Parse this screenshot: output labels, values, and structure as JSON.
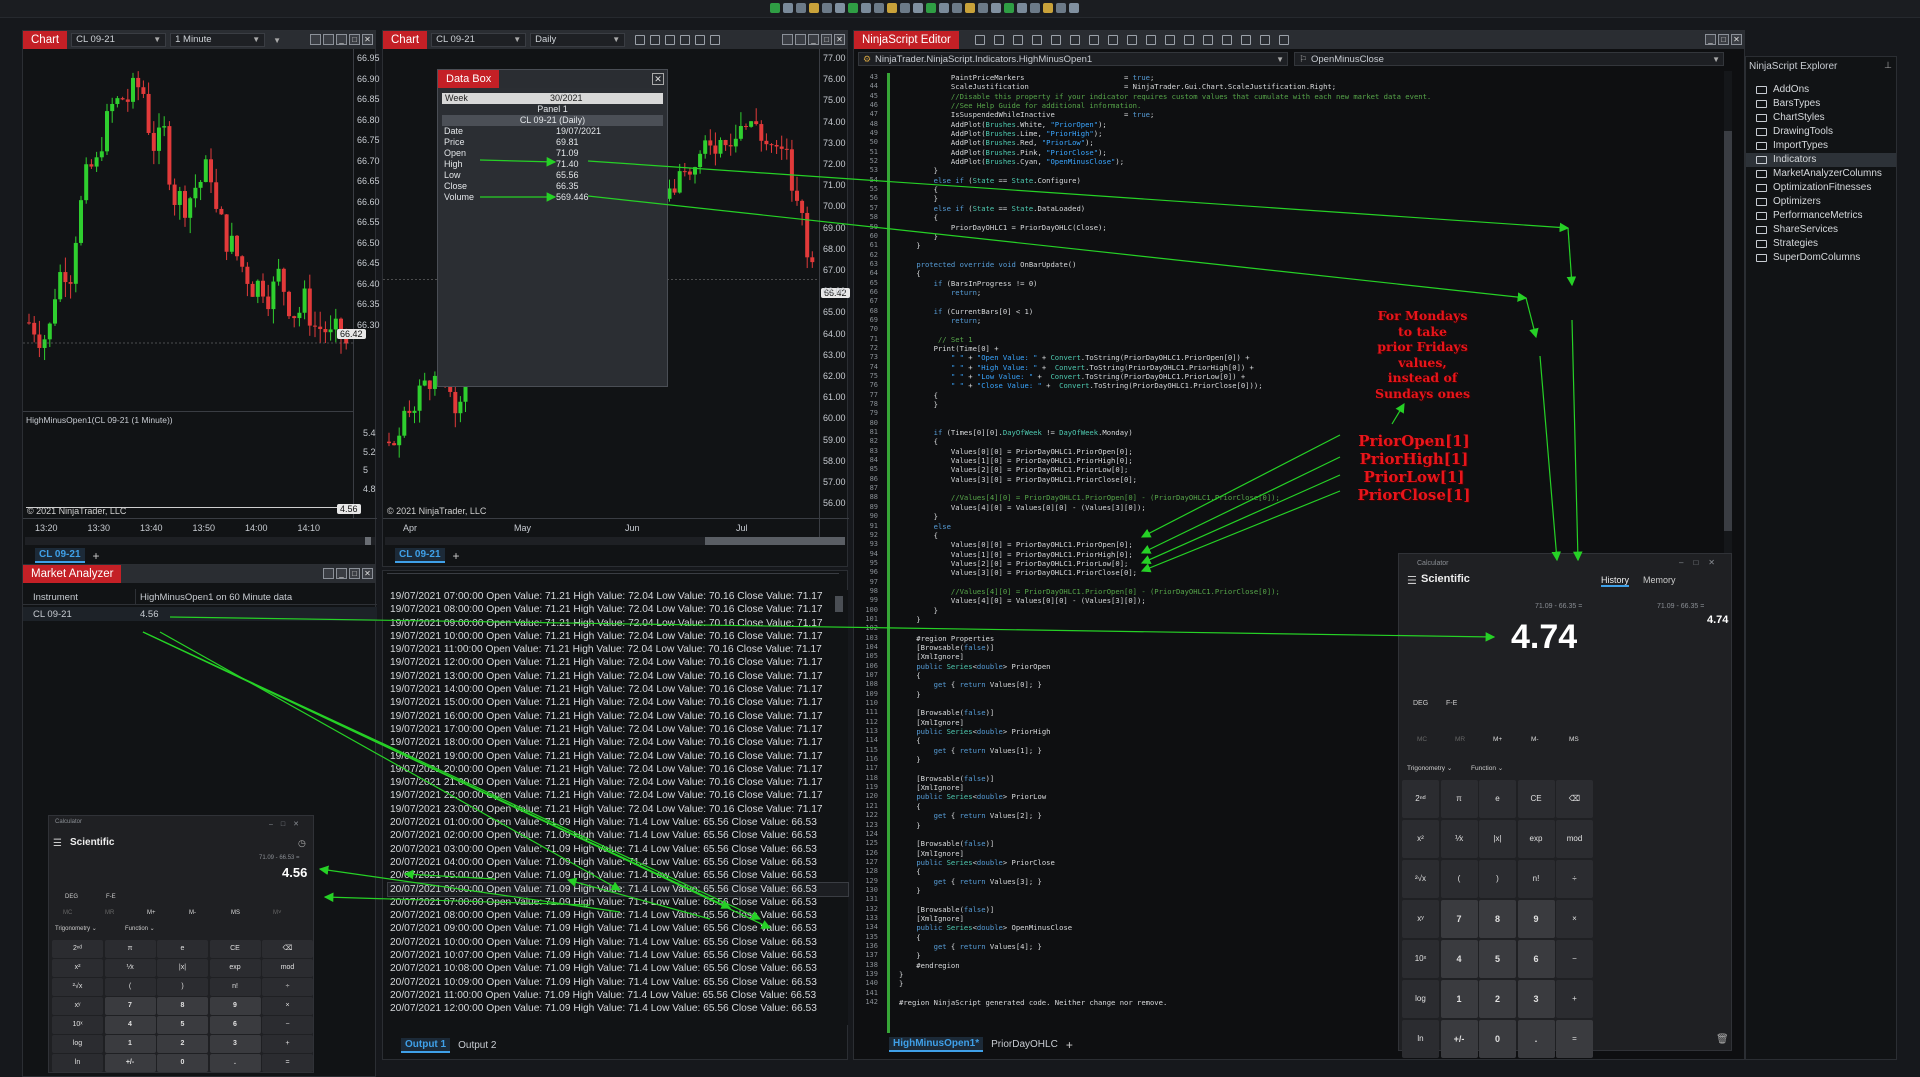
{
  "top": {
    "icons": 24
  },
  "chart1": {
    "tab": "Chart",
    "instrument": "CL 09-21",
    "interval": "1 Minute",
    "prices": [
      "66.95",
      "66.90",
      "66.85",
      "66.80",
      "66.75",
      "66.70",
      "66.65",
      "66.60",
      "66.55",
      "66.50",
      "66.45",
      "66.40",
      "66.35",
      "66.30"
    ],
    "last_price": "66.42",
    "indicator_label": "HighMinusOpen1(CL 09-21 (1 Minute))",
    "indicator_ticks": [
      "5.4",
      "5.2",
      "5",
      "4.8"
    ],
    "indicator_value": "4.56",
    "times": [
      "13:20",
      "13:30",
      "13:40",
      "13:50",
      "14:00",
      "14:10"
    ],
    "copyright": "© 2021 NinjaTrader, LLC",
    "bottom_tab": "CL 09-21",
    "plus": "+"
  },
  "chart2": {
    "tab": "Chart",
    "instrument": "CL 09-21",
    "interval": "Daily",
    "prices": [
      "77.00",
      "76.00",
      "75.00",
      "74.00",
      "73.00",
      "72.00",
      "71.00",
      "70.00",
      "69.00",
      "68.00",
      "67.00",
      "66.00",
      "65.00",
      "64.00",
      "63.00",
      "62.00",
      "61.00",
      "60.00",
      "59.00",
      "58.00",
      "57.00",
      "56.00"
    ],
    "last_price": "66.42",
    "months": [
      "Apr",
      "May",
      "Jun",
      "Jul"
    ],
    "copyright": "© 2021 NinjaTrader, LLC",
    "bottom_tab": "CL 09-21",
    "plus": "+"
  },
  "databox": {
    "title": "Data Box",
    "close": "✕",
    "week_label": "Week",
    "week_value": "30/2021",
    "panel": "Panel 1",
    "series": "CL 09-21 (Daily)",
    "rows": [
      {
        "k": "Date",
        "v": "19/07/2021"
      },
      {
        "k": "Price",
        "v": "69.81"
      },
      {
        "k": "Open",
        "v": "71.09"
      },
      {
        "k": "High",
        "v": "71.40"
      },
      {
        "k": "Low",
        "v": "65.56"
      },
      {
        "k": "Close",
        "v": "66.35"
      },
      {
        "k": "Volume",
        "v": "569.446"
      }
    ]
  },
  "market_analyzer": {
    "tab": "Market Analyzer",
    "col1": "Instrument",
    "col2": "HighMinusOpen1 on 60 Minute data",
    "row_instrument": "CL 09-21",
    "row_value": "4.56"
  },
  "output": {
    "lines": [
      "19/07/2021 07:00:00 Open Value: 71.21 High Value: 72.04 Low Value: 70.16 Close Value: 71.17",
      "19/07/2021 08:00:00 Open Value: 71.21 High Value: 72.04 Low Value: 70.16 Close Value: 71.17",
      "19/07/2021 09:00:00 Open Value: 71.21 High Value: 72.04 Low Value: 70.16 Close Value: 71.17",
      "19/07/2021 10:00:00 Open Value: 71.21 High Value: 72.04 Low Value: 70.16 Close Value: 71.17",
      "19/07/2021 11:00:00 Open Value: 71.21 High Value: 72.04 Low Value: 70.16 Close Value: 71.17",
      "19/07/2021 12:00:00 Open Value: 71.21 High Value: 72.04 Low Value: 70.16 Close Value: 71.17",
      "19/07/2021 13:00:00 Open Value: 71.21 High Value: 72.04 Low Value: 70.16 Close Value: 71.17",
      "19/07/2021 14:00:00 Open Value: 71.21 High Value: 72.04 Low Value: 70.16 Close Value: 71.17",
      "19/07/2021 15:00:00 Open Value: 71.21 High Value: 72.04 Low Value: 70.16 Close Value: 71.17",
      "19/07/2021 16:00:00 Open Value: 71.21 High Value: 72.04 Low Value: 70.16 Close Value: 71.17",
      "19/07/2021 17:00:00 Open Value: 71.21 High Value: 72.04 Low Value: 70.16 Close Value: 71.17",
      "19/07/2021 18:00:00 Open Value: 71.21 High Value: 72.04 Low Value: 70.16 Close Value: 71.17",
      "19/07/2021 19:00:00 Open Value: 71.21 High Value: 72.04 Low Value: 70.16 Close Value: 71.17",
      "19/07/2021 20:00:00 Open Value: 71.21 High Value: 72.04 Low Value: 70.16 Close Value: 71.17",
      "19/07/2021 21:00:00 Open Value: 71.21 High Value: 72.04 Low Value: 70.16 Close Value: 71.17",
      "19/07/2021 22:00:00 Open Value: 71.21 High Value: 72.04 Low Value: 70.16 Close Value: 71.17",
      "19/07/2021 23:00:00 Open Value: 71.21 High Value: 72.04 Low Value: 70.16 Close Value: 71.17",
      "20/07/2021 01:00:00 Open Value: 71.09 High Value: 71.4 Low Value: 65.56 Close Value: 66.53",
      "20/07/2021 02:00:00 Open Value: 71.09 High Value: 71.4 Low Value: 65.56 Close Value: 66.53",
      "20/07/2021 03:00:00 Open Value: 71.09 High Value: 71.4 Low Value: 65.56 Close Value: 66.53",
      "20/07/2021 04:00:00 Open Value: 71.09 High Value: 71.4 Low Value: 65.56 Close Value: 66.53",
      "20/07/2021 05:00:00 Open Value: 71.09 High Value: 71.4 Low Value: 65.56 Close Value: 66.53",
      "20/07/2021 06:00:00 Open Value: 71.09 High Value: 71.4 Low Value: 65.56 Close Value: 66.53",
      "20/07/2021 07:00:00 Open Value: 71.09 High Value: 71.4 Low Value: 65.56 Close Value: 66.53",
      "20/07/2021 08:00:00 Open Value: 71.09 High Value: 71.4 Low Value: 65.56 Close Value: 66.53",
      "20/07/2021 09:00:00 Open Value: 71.09 High Value: 71.4 Low Value: 65.56 Close Value: 66.53",
      "20/07/2021 10:00:00 Open Value: 71.09 High Value: 71.4 Low Value: 65.56 Close Value: 66.53",
      "20/07/2021 10:07:00 Open Value: 71.09 High Value: 71.4 Low Value: 65.56 Close Value: 66.53",
      "20/07/2021 10:08:00 Open Value: 71.09 High Value: 71.4 Low Value: 65.56 Close Value: 66.53",
      "20/07/2021 10:09:00 Open Value: 71.09 High Value: 71.4 Low Value: 65.56 Close Value: 66.53",
      "20/07/2021 11:00:00 Open Value: 71.09 High Value: 71.4 Low Value: 65.56 Close Value: 66.53",
      "20/07/2021 12:00:00 Open Value: 71.09 High Value: 71.4 Low Value: 65.56 Close Value: 66.53"
    ],
    "tab1": "Output 1",
    "tab2": "Output 2"
  },
  "editor": {
    "tab": "NinjaScript Editor",
    "path": "NinjaTrader.NinjaScript.Indicators.HighMinusOpen1",
    "member": "OpenMinusClose",
    "file_tab1": "HighMinusOpen1*",
    "file_tab2": "PriorDayOHLC",
    "plus": "+",
    "first_line": 43,
    "lines": [
      "            PaintPriceMarkers                       = true;",
      "            ScaleJustification                      = NinjaTrader.Gui.Chart.ScaleJustification.Right;",
      "            //Disable this property if your indicator requires custom values that cumulate with each new market data event.",
      "            //See Help Guide for additional information.",
      "            IsSuspendedWhileInactive                = true;",
      "            AddPlot(Brushes.White, \"PriorOpen\");",
      "            AddPlot(Brushes.Lime, \"PriorHigh\");",
      "            AddPlot(Brushes.Red, \"PriorLow\");",
      "            AddPlot(Brushes.Pink, \"PriorClose\");",
      "            AddPlot(Brushes.Cyan, \"OpenMinusClose\");",
      "        }",
      "        else if (State == State.Configure)",
      "        {",
      "        }",
      "        else if (State == State.DataLoaded)",
      "        {",
      "            PriorDayOHLC1 = PriorDayOHLC(Close);",
      "        }",
      "    }",
      "",
      "    protected override void OnBarUpdate()",
      "    {",
      "        if (BarsInProgress != 0)",
      "            return;",
      "",
      "        if (CurrentBars[0] < 1)",
      "            return;",
      "",
      "         // Set 1",
      "        Print(Time[0] +",
      "            \" \" + \"Open Value: \" + Convert.ToString(PriorDayOHLC1.PriorOpen[0]) +",
      "            \" \" + \"High Value: \" +  Convert.ToString(PriorDayOHLC1.PriorHigh[0]) +",
      "            \" \" + \"Low Value: \" +  Convert.ToString(PriorDayOHLC1.PriorLow[0]) +",
      "            \" \" + \"Close Value: \" +  Convert.ToString(PriorDayOHLC1.PriorClose[0]));",
      "        {",
      "        }",
      "",
      "",
      "        if (Times[0][0].DayOfWeek != DayOfWeek.Monday)",
      "        {",
      "            Values[0][0] = PriorDayOHLC1.PriorOpen[0];",
      "            Values[1][0] = PriorDayOHLC1.PriorHigh[0];",
      "            Values[2][0] = PriorDayOHLC1.PriorLow[0];",
      "            Values[3][0] = PriorDayOHLC1.PriorClose[0];",
      "",
      "            //Values[4][0] = PriorDayOHLC1.PriorOpen[0] - (PriorDayOHLC1.PriorClose[0]);",
      "            Values[4][0] = Values[0][0] - (Values[3][0]);",
      "        }",
      "        else",
      "        {",
      "            Values[0][0] = PriorDayOHLC1.PriorOpen[0];",
      "            Values[1][0] = PriorDayOHLC1.PriorHigh[0];",
      "            Values[2][0] = PriorDayOHLC1.PriorLow[0];",
      "            Values[3][0] = PriorDayOHLC1.PriorClose[0];",
      "",
      "            //Values[4][0] = PriorDayOHLC1.PriorOpen[0] - (PriorDayOHLC1.PriorClose[0]);",
      "            Values[4][0] = Values[0][0] - (Values[3][0]);",
      "        }",
      "    }",
      "",
      "    #region Properties",
      "    [Browsable(false)]",
      "    [XmlIgnore]",
      "    public Series<double> PriorOpen",
      "    {",
      "        get { return Values[0]; }",
      "    }",
      "",
      "    [Browsable(false)]",
      "    [XmlIgnore]",
      "    public Series<double> PriorHigh",
      "    {",
      "        get { return Values[1]; }",
      "    }",
      "",
      "    [Browsable(false)]",
      "    [XmlIgnore]",
      "    public Series<double> PriorLow",
      "    {",
      "        get { return Values[2]; }",
      "    }",
      "",
      "    [Browsable(false)]",
      "    [XmlIgnore]",
      "    public Series<double> PriorClose",
      "    {",
      "        get { return Values[3]; }",
      "    }",
      "",
      "    [Browsable(false)]",
      "    [XmlIgnore]",
      "    public Series<double> OpenMinusClose",
      "    {",
      "        get { return Values[4]; }",
      "    }",
      "    #endregion",
      "}",
      "}",
      "",
      "#region NinjaScript generated code. Neither change nor remove."
    ]
  },
  "explorer": {
    "title": "NinjaScript Explorer",
    "items": [
      "AddOns",
      "BarsTypes",
      "ChartStyles",
      "DrawingTools",
      "ImportTypes",
      "Indicators",
      "MarketAnalyzerColumns",
      "OptimizationFitnesses",
      "Optimizers",
      "PerformanceMetrics",
      "ShareServices",
      "Strategies",
      "SuperDomColumns"
    ],
    "selected": "Indicators"
  },
  "calc_big": {
    "title": "Calculator",
    "mode": "Scientific",
    "history": "History",
    "memory": "Memory",
    "expr": "71.09 - 66.35 =",
    "result": "4.74",
    "hist_expr": "71.09  -  66.35 =",
    "hist_result": "4.74",
    "deg": "DEG",
    "fe": "F-E",
    "mem": [
      "MC",
      "MR",
      "M+",
      "M-",
      "MS"
    ],
    "trig": "Trigonometry",
    "func": "Function",
    "keys": [
      [
        "2ⁿᵈ",
        "π",
        "e",
        "CE",
        "⌫"
      ],
      [
        "x²",
        "⅟x",
        "|x|",
        "exp",
        "mod"
      ],
      [
        "²√x",
        "(",
        ")",
        "n!",
        "÷"
      ],
      [
        "xʸ",
        "7",
        "8",
        "9",
        "×"
      ],
      [
        "10ˣ",
        "4",
        "5",
        "6",
        "−"
      ],
      [
        "log",
        "1",
        "2",
        "3",
        "+"
      ],
      [
        "ln",
        "+/-",
        "0",
        ".",
        "="
      ]
    ]
  },
  "calc_small": {
    "title": "Calculator",
    "mode": "Scientific",
    "expr": "71.09 - 66.53 =",
    "result": "4.56",
    "deg": "DEG",
    "fe": "F-E",
    "mem": [
      "MC",
      "MR",
      "M+",
      "M-",
      "MS",
      "M˅"
    ],
    "trig": "Trigonometry",
    "func": "Function"
  },
  "annotations": {
    "note": [
      "For Mondays",
      "to take",
      "prior Fridays",
      "values,",
      "instead of",
      "Sundays ones"
    ],
    "prior": [
      "PriorOpen[1]",
      "PriorHigh[1]",
      "PriorLow[1]",
      "PriorClose[1]"
    ]
  },
  "colors": {
    "accent_red": "#c42026",
    "green_arrow": "#26d126",
    "up_candle": "#2fcf2f",
    "down_candle": "#e23a3a",
    "tab_blue": "#3fa0e8"
  }
}
